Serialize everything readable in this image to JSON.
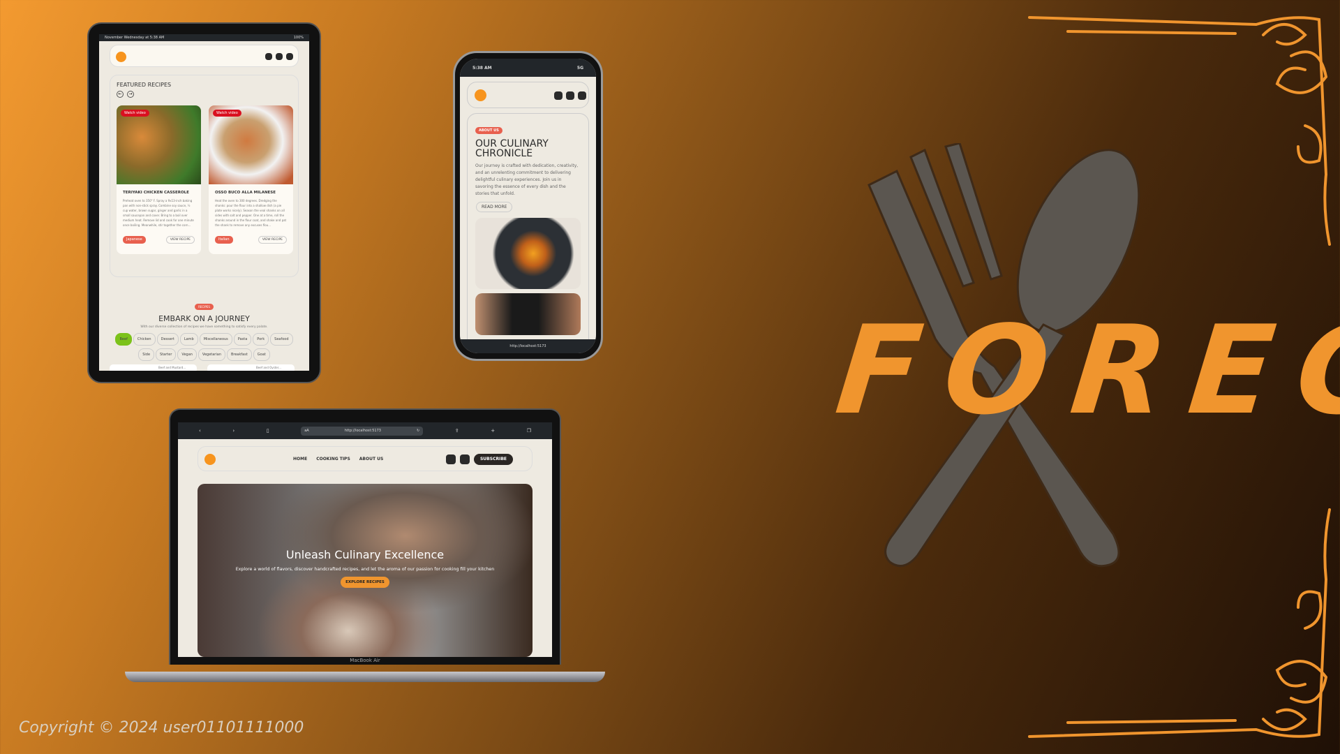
{
  "brand": {
    "name": "FOREC",
    "accent": "#f0952e"
  },
  "copyright": "Copyright © 2024 user01101111000",
  "tablet": {
    "status_left": "November Wednesday at 5:38 AM",
    "status_right": "100%",
    "featured_title": "FEATURED RECIPES",
    "recipes": [
      {
        "badge": "Watch video",
        "title": "TERIYAKI CHICKEN CASSEROLE",
        "desc": "Preheat oven to 350° F. Spray a 9x13-inch baking pan with non-stick spray. Combine soy sauce, ½ cup water, brown sugar, ginger and garlic in a small saucepan and cover. Bring to a boil over medium heat. Remove lid and cook for one minute once boiling. Meanwhile, stir together the corn...",
        "cuisine": "Japanese",
        "button": "VIEW RECIPE"
      },
      {
        "badge": "Watch video",
        "title": "OSSO BUCO ALLA MILANESE",
        "desc": "Heat the oven to 300 degrees. Dredging the shanks: pour the flour into a shallow dish (a pie plate works nicely). Season the veal shanks on all sides with salt and pepper. One at a time, roll the shanks around in the flour coat, and shake and pat the shank to remove any excuses flou...",
        "cuisine": "Italian",
        "button": "VIEW RECIPE"
      }
    ],
    "section_tag": "RECIPES",
    "section_title": "EMBARK ON A JOURNEY",
    "section_desc": "With our diverse collection of recipes we have something to satisfy every palate.",
    "categories": [
      "Beef",
      "Chicken",
      "Dessert",
      "Lamb",
      "Miscellaneous",
      "Pasta",
      "Pork",
      "Seafood",
      "Side",
      "Starter",
      "Vegan",
      "Vegetarian",
      "Breakfast",
      "Goat"
    ],
    "active_category": "Beef",
    "peek": [
      "Beef and Mustard...",
      "Beef and Oyster..."
    ]
  },
  "phone": {
    "time": "5:38 AM",
    "network": "5G",
    "tag": "ABOUT US",
    "title": "OUR CULINARY CHRONICLE",
    "body": "Our journey is crafted with dedication, creativity, and an unrelenting commitment to delivering delightful culinary experiences. Join us in savoring the essence of every dish and the stories that unfold.",
    "button": "READ MORE",
    "url": "http://localhost:5173"
  },
  "laptop": {
    "url_prefix": "aA",
    "url": "http://localhost:5173",
    "nav": [
      "HOME",
      "COOKING TIPS",
      "ABOUT US"
    ],
    "subscribe": "SUBSCRIBE",
    "hero_title": "Unleash Culinary Excellence",
    "hero_desc": "Explore a world of flavors, discover handcrafted recipes, and let the aroma of our passion for cooking fill your kitchen",
    "hero_button": "EXPLORE RECIPES",
    "model": "MacBook Air"
  }
}
